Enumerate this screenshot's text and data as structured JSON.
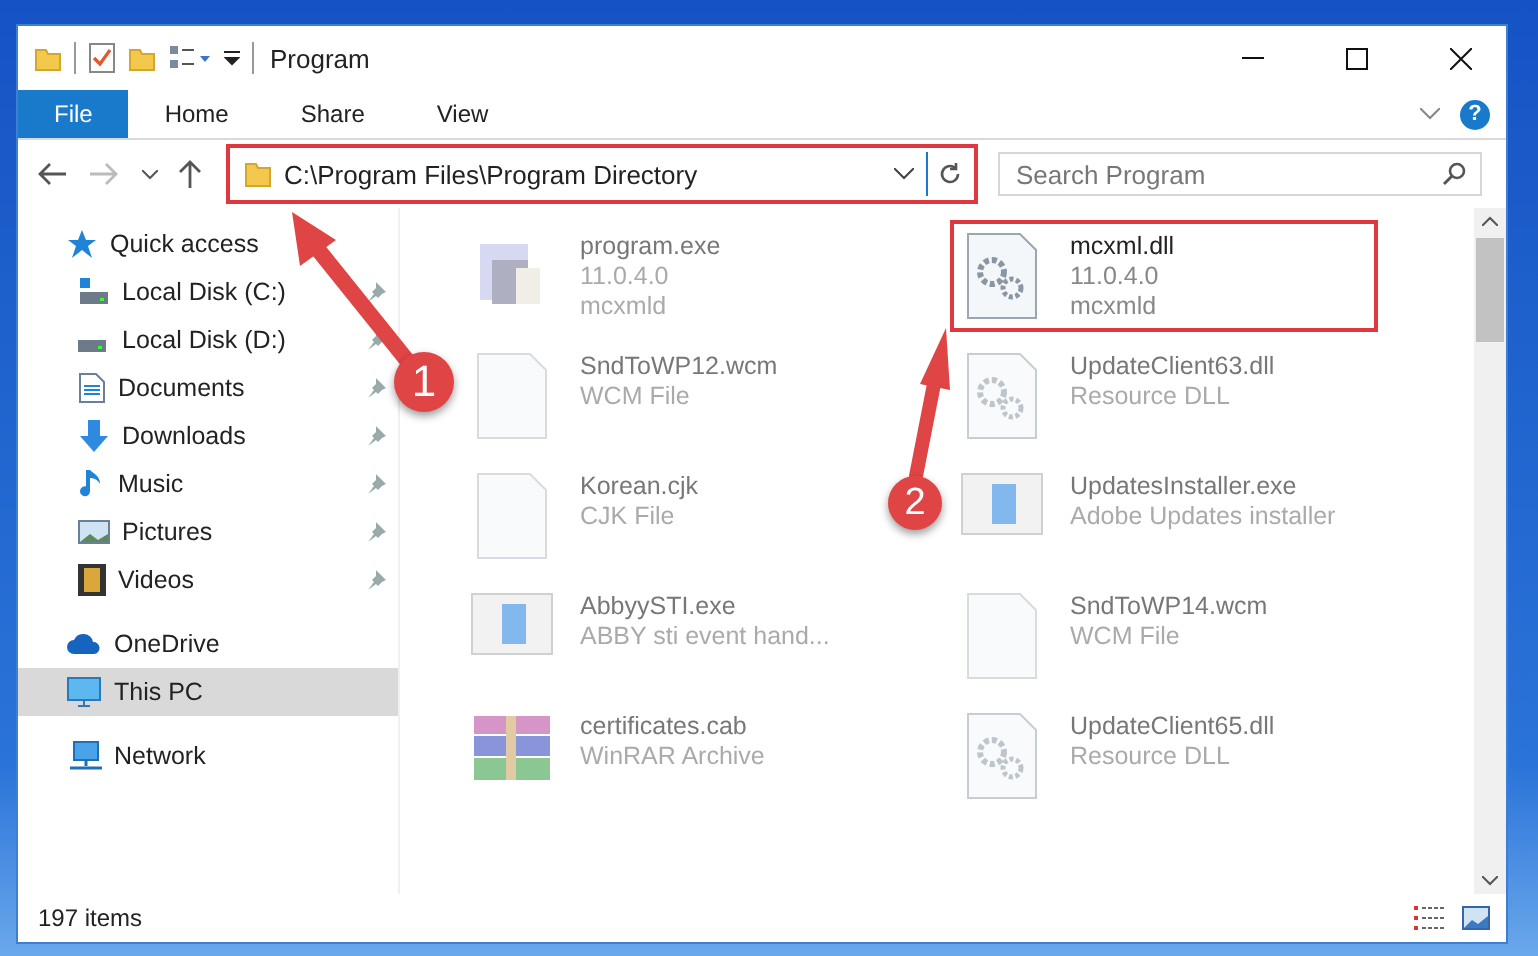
{
  "window": {
    "title": "Program"
  },
  "ribbon_tabs": [
    {
      "label": "File",
      "selected": true
    },
    {
      "label": "Home",
      "selected": false
    },
    {
      "label": "Share",
      "selected": false
    },
    {
      "label": "View",
      "selected": false
    }
  ],
  "help": "?",
  "address": {
    "value": "C:\\Program Files\\Program Directory",
    "highlighted": true
  },
  "search": {
    "placeholder": "Search Program"
  },
  "sidebar": {
    "items": [
      {
        "label": "Quick access",
        "selected": false,
        "children": [
          {
            "label": "Local Disk (C:)",
            "pinned": true,
            "selected": false
          },
          {
            "label": "Local Disk (D:)",
            "pinned": true,
            "selected": false
          },
          {
            "label": "Documents",
            "pinned": true,
            "selected": false
          },
          {
            "label": "Downloads",
            "pinned": true,
            "selected": false
          },
          {
            "label": "Music",
            "pinned": true,
            "selected": false
          },
          {
            "label": "Pictures",
            "pinned": true,
            "selected": false
          },
          {
            "label": "Videos",
            "pinned": true,
            "selected": false
          }
        ]
      },
      {
        "label": "OneDrive",
        "selected": false
      },
      {
        "label": "This PC",
        "selected": true
      },
      {
        "label": "Network",
        "selected": false
      }
    ]
  },
  "files": [
    {
      "name": "program.exe",
      "details": [
        "11.0.4.0",
        "mcxmld"
      ],
      "blurred": true,
      "highlighted": false
    },
    {
      "name": "mcxml.dll",
      "details": [
        "11.0.4.0",
        "mcxmld"
      ],
      "blurred": false,
      "highlighted": true
    },
    {
      "name": "SndToWP12.wcm",
      "details": [
        "WCM File"
      ],
      "blurred": true,
      "highlighted": false
    },
    {
      "name": "UpdateClient63.dll",
      "details": [
        "Resource DLL"
      ],
      "blurred": true,
      "highlighted": false
    },
    {
      "name": "Korean.cjk",
      "details": [
        "CJK File"
      ],
      "blurred": true,
      "highlighted": false
    },
    {
      "name": "UpdatesInstaller.exe",
      "details": [
        "Adobe Updates installer"
      ],
      "blurred": true,
      "highlighted": false
    },
    {
      "name": "AbbyySTI.exe",
      "details": [
        "ABBY sti event hand..."
      ],
      "blurred": true,
      "highlighted": false
    },
    {
      "name": "SndToWP14.wcm",
      "details": [
        "WCM File"
      ],
      "blurred": true,
      "highlighted": false
    },
    {
      "name": "certificates.cab",
      "details": [
        "WinRAR Archive"
      ],
      "blurred": true,
      "highlighted": false
    },
    {
      "name": "UpdateClient65.dll",
      "details": [
        "Resource DLL"
      ],
      "blurred": true,
      "highlighted": false
    }
  ],
  "status_bar": {
    "count": "197 items"
  },
  "markers": [
    {
      "number": "1"
    },
    {
      "number": "2"
    }
  ]
}
